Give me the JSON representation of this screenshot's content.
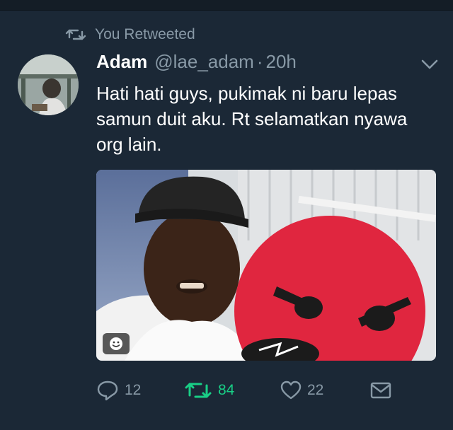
{
  "retweet_context": {
    "text": "You Retweeted"
  },
  "tweet": {
    "author_name": "Adam",
    "handle": "@lae_adam",
    "separator": "·",
    "time": "20h",
    "text": "Hati hati guys, pukimak ni baru lepas samun duit aku. Rt selamatkan nyawa org lain."
  },
  "actions": {
    "reply_count": "12",
    "retweet_count": "84",
    "like_count": "22"
  },
  "colors": {
    "background": "#1b2836",
    "muted": "#8899a6",
    "retweet_active": "#19cf86",
    "emoji_red": "#e0263f"
  },
  "icons": {
    "retweet_context": "retweet-icon",
    "menu": "chevron-down-icon",
    "reply": "reply-icon",
    "retweet": "retweet-icon",
    "like": "heart-icon",
    "dm": "envelope-icon",
    "sticker": "smiley-sticker-icon"
  }
}
